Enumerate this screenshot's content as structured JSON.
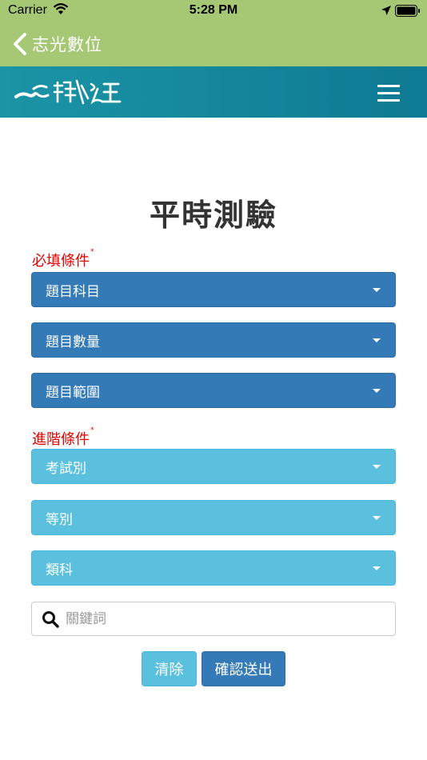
{
  "status_bar": {
    "carrier": "Carrier",
    "time": "5:28 PM"
  },
  "nav": {
    "back_label": "志光數位"
  },
  "header": {
    "logo_alt": "公職王"
  },
  "page": {
    "title": "平時測驗"
  },
  "required": {
    "label": "必填條件",
    "marker": "*",
    "selects": [
      {
        "label": "題目科目"
      },
      {
        "label": "題目數量"
      },
      {
        "label": "題目範圍"
      }
    ]
  },
  "advanced": {
    "label": "進階條件",
    "marker": "*",
    "selects": [
      {
        "label": "考試別"
      },
      {
        "label": "等別"
      },
      {
        "label": "類科"
      }
    ]
  },
  "search": {
    "placeholder": "關鍵詞",
    "value": ""
  },
  "buttons": {
    "clear": "清除",
    "submit": "確認送出"
  },
  "colors": {
    "nav_green": "#a6c774",
    "header_teal": "#0e7a93",
    "primary_blue": "#337ab7",
    "info_cyan": "#5bc0de",
    "required_red": "#e60000"
  }
}
